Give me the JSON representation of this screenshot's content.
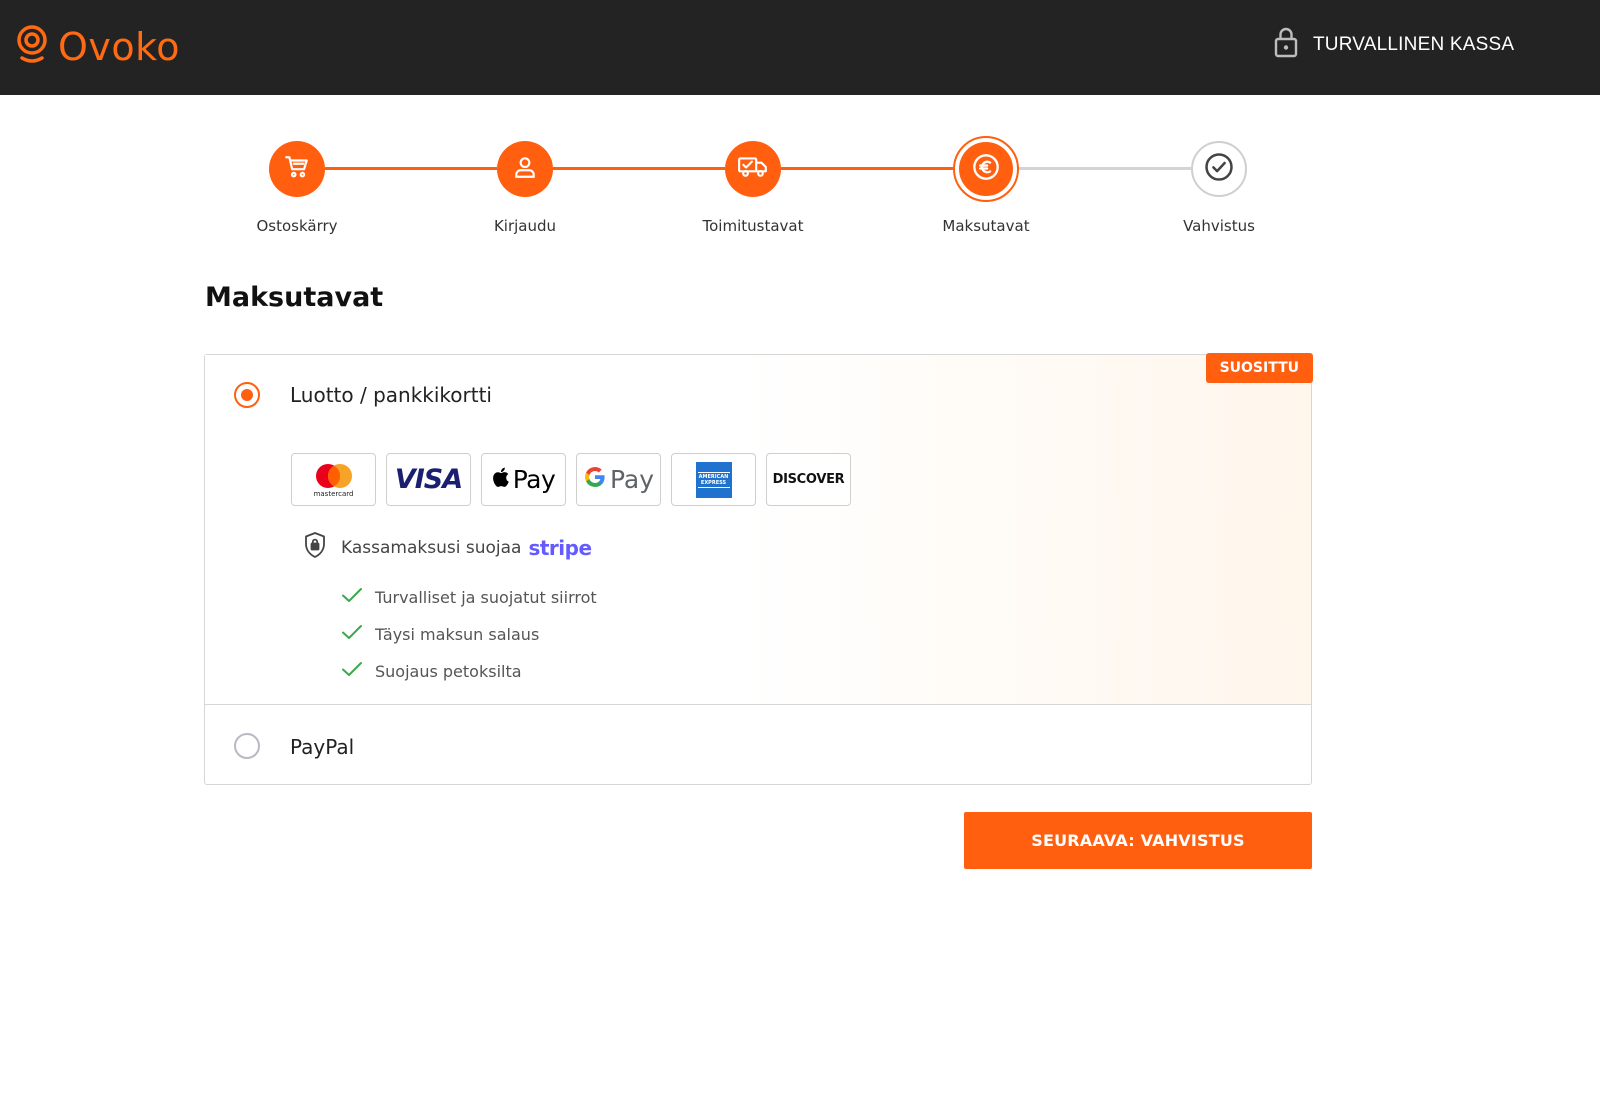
{
  "header": {
    "brand": "Ovoko",
    "secure_label": "TURVALLINEN KASSA",
    "icons": {
      "logo": "ovoko-logo-icon",
      "secure": "padlock-icon"
    }
  },
  "stepper": {
    "steps": [
      {
        "label": "Ostoskärry",
        "icon": "cart-icon",
        "state": "done"
      },
      {
        "label": "Kirjaudu",
        "icon": "user-icon",
        "state": "done"
      },
      {
        "label": "Toimitustavat",
        "icon": "truck-icon",
        "state": "done"
      },
      {
        "label": "Maksutavat",
        "icon": "euro-icon",
        "state": "current"
      },
      {
        "label": "Vahvistus",
        "icon": "check-circle-icon",
        "state": "pending"
      }
    ]
  },
  "page": {
    "title": "Maksutavat"
  },
  "payment": {
    "options": [
      {
        "label": "Luotto / pankkikortti",
        "selected": true,
        "badge": "SUOSITTU"
      },
      {
        "label": "PayPal",
        "selected": false
      }
    ],
    "methods": [
      {
        "name": "mastercard",
        "text": "mastercard"
      },
      {
        "name": "visa",
        "text": "VISA"
      },
      {
        "name": "apple-pay",
        "text": "Pay"
      },
      {
        "name": "google-pay",
        "text": "Pay"
      },
      {
        "name": "american-express",
        "text": "AMERICAN EXPRESS"
      },
      {
        "name": "discover",
        "text": "DISCOVER"
      }
    ],
    "stripe": {
      "text": "Kassamaksusi suojaa",
      "brand": "stripe"
    },
    "features": [
      "Turvalliset ja suojatut siirrot",
      "Täysi maksun salaus",
      "Suojaus petoksilta"
    ]
  },
  "actions": {
    "next_label": "SEURAAVA: VAHVISTUS"
  },
  "colors": {
    "accent": "#ff5f0f",
    "header_bg": "#232323",
    "stripe": "#635bff",
    "check": "#3aa84a"
  }
}
